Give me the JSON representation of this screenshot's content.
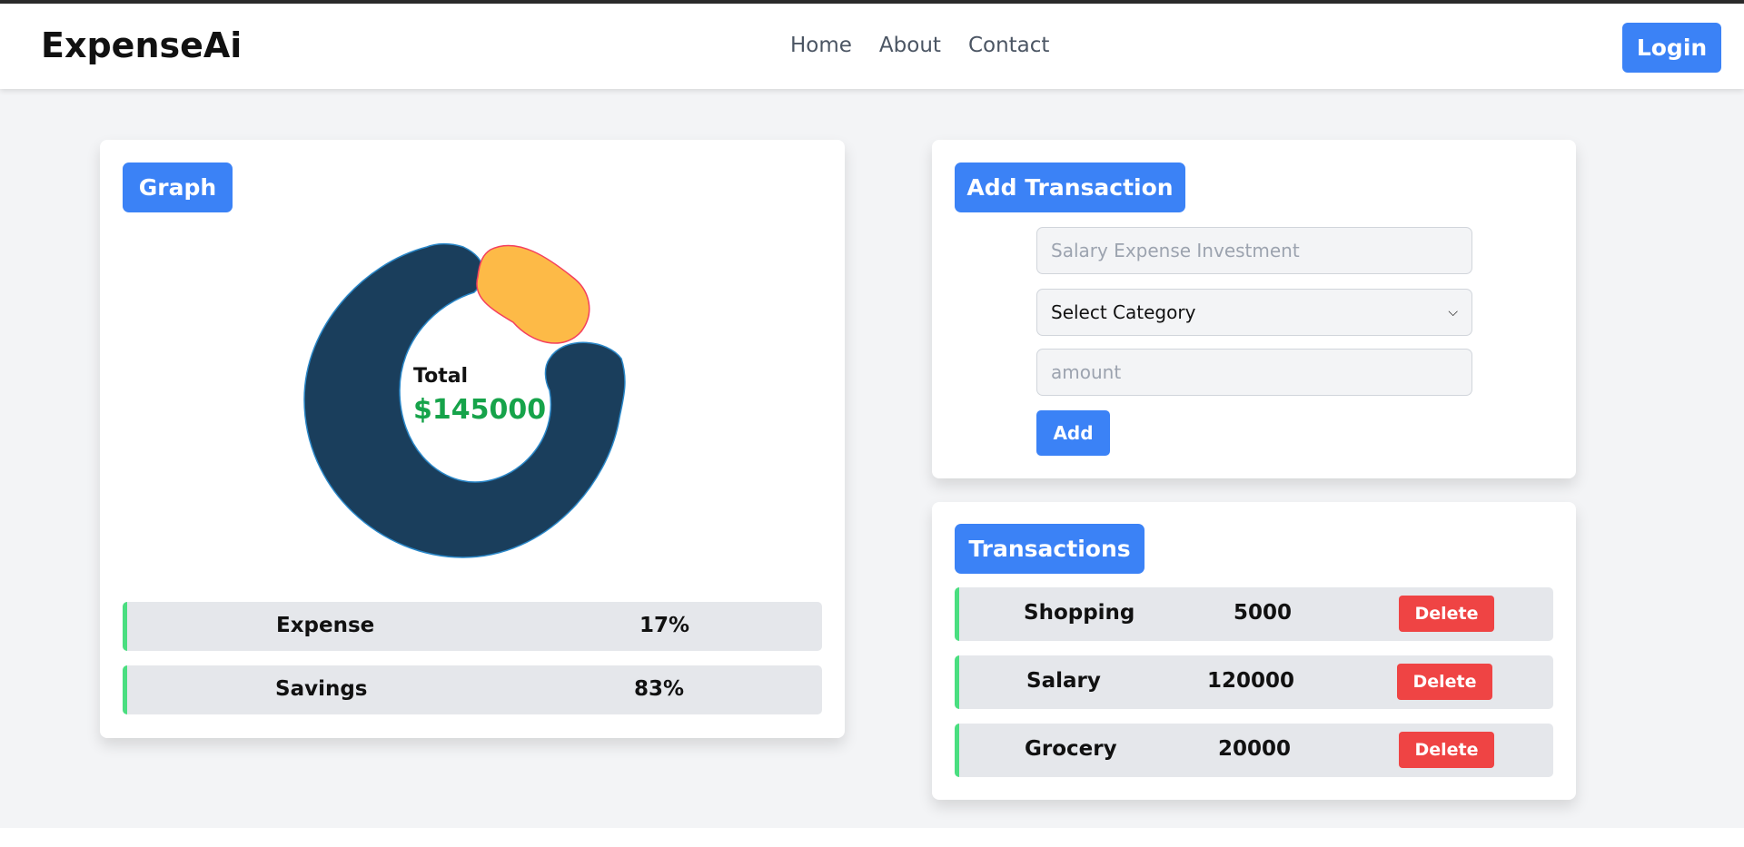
{
  "navbar": {
    "brand": "ExpenseAi",
    "links": [
      "Home",
      "About",
      "Contact"
    ],
    "login_label": "Login"
  },
  "graph": {
    "badge": "Graph",
    "total_label": "Total",
    "total_value": "$145000",
    "colors": {
      "savings": "#1a3e5c",
      "expense": "#fdba47",
      "expense_outline": "#f43f5e",
      "total": "#16a34a"
    },
    "stats": [
      {
        "name": "Expense",
        "pct": "17%"
      },
      {
        "name": "Savings",
        "pct": "83%"
      }
    ]
  },
  "add_transaction": {
    "badge": "Add Transaction",
    "description_placeholder": "Salary Expense Investment",
    "category_value": "Select Category",
    "amount_placeholder": "amount",
    "add_label": "Add"
  },
  "transactions": {
    "badge": "Transactions",
    "delete_label": "Delete",
    "items": [
      {
        "name": "Shopping",
        "amount": "5000"
      },
      {
        "name": "Salary",
        "amount": "120000"
      },
      {
        "name": "Grocery",
        "amount": "20000"
      }
    ]
  },
  "colors": {
    "accent": "#3b82f6",
    "danger": "#ef4444",
    "row_marker": "#4ade80",
    "page_bg": "#f3f4f6"
  }
}
